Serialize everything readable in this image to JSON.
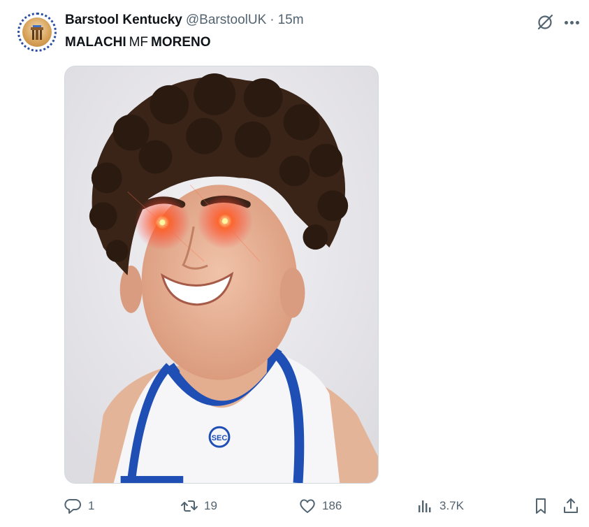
{
  "author": {
    "display_name": "Barstool Kentucky",
    "handle": "@BarstoolUK",
    "separator": "·",
    "time": "15m",
    "avatar_icon": "barstool-kentucky-logo-icon"
  },
  "tweet": {
    "text_parts": [
      {
        "text": "MALACHI",
        "weight": "bold"
      },
      {
        "text": "MF",
        "weight": "regular"
      },
      {
        "text": "MORENO",
        "weight": "bold"
      }
    ],
    "media": {
      "kind": "photo",
      "description_icon": "player-photo-laser-eyes",
      "jersey_badge": "SEC"
    }
  },
  "top_actions": {
    "grok_icon": "grok-icon",
    "more_icon": "more-icon"
  },
  "actions": {
    "reply": {
      "icon": "reply-icon",
      "count": "1"
    },
    "retweet": {
      "icon": "retweet-icon",
      "count": "19"
    },
    "like": {
      "icon": "like-icon",
      "count": "186"
    },
    "views": {
      "icon": "views-icon",
      "count": "3.7K"
    },
    "bookmark": {
      "icon": "bookmark-icon"
    },
    "share": {
      "icon": "share-icon"
    }
  },
  "colors": {
    "text_primary": "#0f1419",
    "text_secondary": "#536471",
    "border": "#cfd9de",
    "jersey_blue": "#1f4fb5"
  }
}
